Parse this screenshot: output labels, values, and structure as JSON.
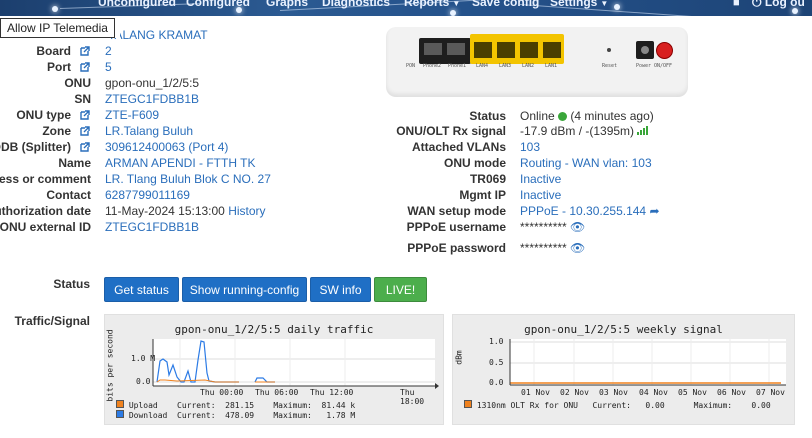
{
  "navbar": {
    "items": [
      {
        "label": "Unconfigured",
        "has_caret": false
      },
      {
        "label": "Configured",
        "has_caret": false
      },
      {
        "label": "Graphs",
        "has_caret": false
      },
      {
        "label": "Diagnostics",
        "has_caret": false
      },
      {
        "label": "Reports",
        "has_caret": true
      },
      {
        "label": "Save config",
        "has_caret": false
      },
      {
        "label": "Settings",
        "has_caret": true
      }
    ],
    "user_label": "Log ou"
  },
  "tooltip": "Allow IP Telemedia",
  "details_left": [
    {
      "label": "",
      "value": "TALANG KRAMAT",
      "link": true,
      "icon": false
    },
    {
      "label": "Board",
      "value": "2",
      "link": true,
      "icon": true
    },
    {
      "label": "Port",
      "value": "5",
      "link": true,
      "icon": true
    },
    {
      "label": "ONU",
      "value": "gpon-onu_1/2/5:5",
      "link": false,
      "icon": false
    },
    {
      "label": "SN",
      "value": "ZTEGC1FDBB1B",
      "link": true,
      "icon": false
    },
    {
      "label": "ONU type",
      "value": "ZTE-F609",
      "link": true,
      "icon": true
    },
    {
      "label": "Zone",
      "value": "LR.Talang Buluh",
      "link": true,
      "icon": true
    },
    {
      "label": "ODB (Splitter)",
      "value": "309612400063 (Port 4)",
      "link": true,
      "icon": true
    },
    {
      "label": "Name",
      "value": "ARMAN APENDI - FTTH TK",
      "link": true,
      "icon": false
    },
    {
      "label": "Address or comment",
      "value": "LR. Tlang Buluh Blok C NO. 27",
      "link": true,
      "icon": false
    },
    {
      "label": "Contact",
      "value": "6287799011169",
      "link": true,
      "icon": false
    },
    {
      "label": "Authorization date",
      "value": "11-May-2024 15:13:00",
      "link": false,
      "icon": false,
      "extra_link": "History"
    },
    {
      "label": "ONU external ID",
      "value": "ZTEGC1FDBB1B",
      "link": true,
      "icon": false
    }
  ],
  "device": {
    "ports_left": [
      "PON",
      "Phone2",
      "Phone1"
    ],
    "lan_ports": [
      "LAN4",
      "LAN3",
      "LAN2",
      "LAN1"
    ],
    "reset": "Reset",
    "power": "Power",
    "onoff": "ON/OFF"
  },
  "details_right": [
    {
      "label": "Status",
      "value": "Online",
      "suffix": "(4 minutes ago)",
      "link": false
    },
    {
      "label": "ONU/OLT Rx signal",
      "value": "-17.9 dBm / -(1395m)",
      "link": false
    },
    {
      "label": "Attached VLANs",
      "value": "103",
      "link": true
    },
    {
      "label": "ONU mode",
      "value": "Routing - WAN vlan: 103",
      "link": true
    },
    {
      "label": "TR069",
      "value": "Inactive",
      "link": true
    },
    {
      "label": "Mgmt IP",
      "value": "Inactive",
      "link": true
    },
    {
      "label": "WAN setup mode",
      "value": "PPPoE - 10.30.255.144",
      "link": true
    },
    {
      "label": "PPPoE username",
      "value": "**********",
      "link": false
    },
    {
      "label": "PPPoE password",
      "value": "**********",
      "link": false
    }
  ],
  "status_section": {
    "label": "Status",
    "buttons": [
      "Get status",
      "Show running-config",
      "SW info",
      "LIVE!"
    ]
  },
  "traffic": {
    "label": "Traffic/Signal",
    "daily": {
      "title": "gpon-onu_1/2/5:5 daily traffic",
      "ylabel": "bits per second",
      "yticks": [
        "1.0 M",
        "0.0"
      ],
      "xticks": [
        "Thu 00:00",
        "Thu 06:00",
        "Thu 12:00",
        "Thu 18:00"
      ],
      "legend": [
        {
          "name": "Upload",
          "color": "#f0821e",
          "current_label": "Current:",
          "current": "281.15",
          "max_label": "Maximum:",
          "maximum": "81.44 k"
        },
        {
          "name": "Download",
          "color": "#2c7be5",
          "current_label": "Current:",
          "current": "478.09",
          "max_label": "Maximum:",
          "maximum": "1.78 M"
        }
      ]
    },
    "weekly": {
      "title": "gpon-onu_1/2/5:5 weekly signal",
      "ylabel": "dBm",
      "yticks": [
        "1.0",
        "0.5",
        "0.0"
      ],
      "xticks": [
        "01 Nov",
        "02 Nov",
        "03 Nov",
        "04 Nov",
        "05 Nov",
        "06 Nov",
        "07 Nov"
      ],
      "legend": [
        {
          "name": "1310nm OLT Rx for ONU",
          "color": "#f0821e",
          "current_label": "Current:",
          "current": "0.00",
          "max_label": "Maximum:",
          "maximum": "0.00"
        }
      ]
    }
  },
  "colors": {
    "link": "#2a6ebb",
    "button_blue": "#1f6fc5",
    "button_green": "#4cae4c",
    "online_green": "#3aa63a"
  }
}
